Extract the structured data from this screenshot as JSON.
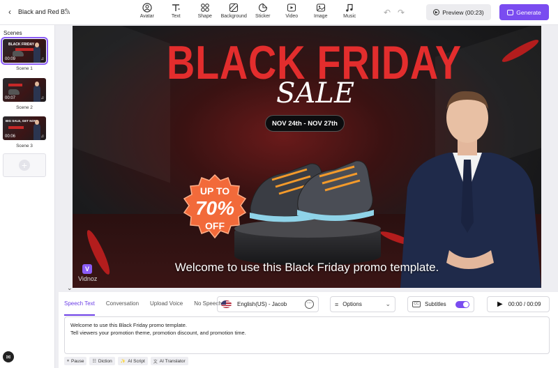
{
  "header": {
    "project_title": "Black and Red B...",
    "tools": [
      {
        "label": "Avatar",
        "icon": "avatar-icon"
      },
      {
        "label": "Text",
        "icon": "text-icon"
      },
      {
        "label": "Shape",
        "icon": "shape-icon"
      },
      {
        "label": "Background",
        "icon": "background-icon"
      },
      {
        "label": "Sticker",
        "icon": "sticker-icon"
      },
      {
        "label": "Video",
        "icon": "video-icon"
      },
      {
        "label": "Image",
        "icon": "image-icon"
      },
      {
        "label": "Music",
        "icon": "music-icon"
      }
    ],
    "preview_label": "Preview (00:23)",
    "generate_label": "Generate"
  },
  "sidebar": {
    "title": "Scenes",
    "scenes": [
      {
        "label": "Scene 1",
        "duration": "00:09",
        "thumb_text": "BLACK FRIDAY",
        "active": true
      },
      {
        "label": "Scene 2",
        "duration": "00:07",
        "thumb_text": "",
        "active": false
      },
      {
        "label": "Scene 3",
        "duration": "00:06",
        "thumb_text": "BIG SALE, GET NOW!",
        "active": false
      }
    ]
  },
  "canvas": {
    "headline": "BLACK FRIDAY",
    "sale": "SALE",
    "dates": "NOV 24th - NOV 27th",
    "badge_line1": "UP TO",
    "badge_line2": "70%",
    "badge_line3": "OFF",
    "subtitle": "Welcome to use this Black Friday promo template.",
    "watermark": "Vidnoz",
    "colors": {
      "headline": "#e32d2d",
      "badge": "#f26a3a",
      "accent": "#7a4cf0"
    }
  },
  "panel": {
    "tabs": [
      {
        "label": "Speech Text",
        "active": true
      },
      {
        "label": "Conversation",
        "active": false
      },
      {
        "label": "Upload Voice",
        "active": false
      },
      {
        "label": "No Speech",
        "active": false
      }
    ],
    "voice": "English(US) - Jacob",
    "options_label": "Options",
    "subtitles_label": "Subtitles",
    "subtitles_on": true,
    "time": "00:00 / 00:09",
    "script_lines": [
      "Welcome to use this Black Friday promo template.",
      "Tell viewers your promotion theme, promotion discount, and promotion time."
    ],
    "chips": [
      {
        "label": "Pause",
        "icon": "pause-icon"
      },
      {
        "label": "Diction",
        "icon": "diction-icon"
      },
      {
        "label": "AI Script",
        "icon": "ai-script-icon"
      },
      {
        "label": "AI Translator",
        "icon": "translator-icon"
      }
    ]
  }
}
